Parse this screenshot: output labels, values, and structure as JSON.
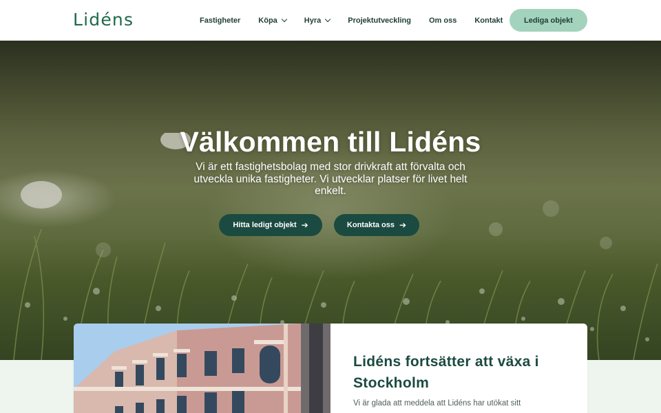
{
  "header": {
    "logo": "Lidéns",
    "nav": [
      {
        "label": "Fastigheter",
        "has_dropdown": false
      },
      {
        "label": "Köpa",
        "has_dropdown": true
      },
      {
        "label": "Hyra",
        "has_dropdown": true
      },
      {
        "label": "Projektutveckling",
        "has_dropdown": false
      },
      {
        "label": "Om oss",
        "has_dropdown": false
      },
      {
        "label": "Kontakt",
        "has_dropdown": false
      }
    ],
    "cta_label": "Lediga objekt"
  },
  "hero": {
    "title": "Välkommen till Lidéns",
    "subtitle": "Vi är ett fastighetsbolag med stor drivkraft att förvalta och utveckla unika fastigheter. Vi utvecklar platser för livet helt enkelt.",
    "buttons": [
      {
        "label": "Hitta ledigt objekt",
        "icon": "arrow-right-icon"
      },
      {
        "label": "Kontakta oss",
        "icon": "arrow-right-icon"
      }
    ]
  },
  "news": {
    "title": "Lidéns fortsätter att växa i Stockholm",
    "excerpt": "Vi är glada att meddela att Lidéns har utökat sitt"
  },
  "colors": {
    "brand_green": "#1e6a4a",
    "dark_green": "#1b4a40",
    "mint": "#a3d3bd",
    "section_bg": "#eef5ef"
  }
}
